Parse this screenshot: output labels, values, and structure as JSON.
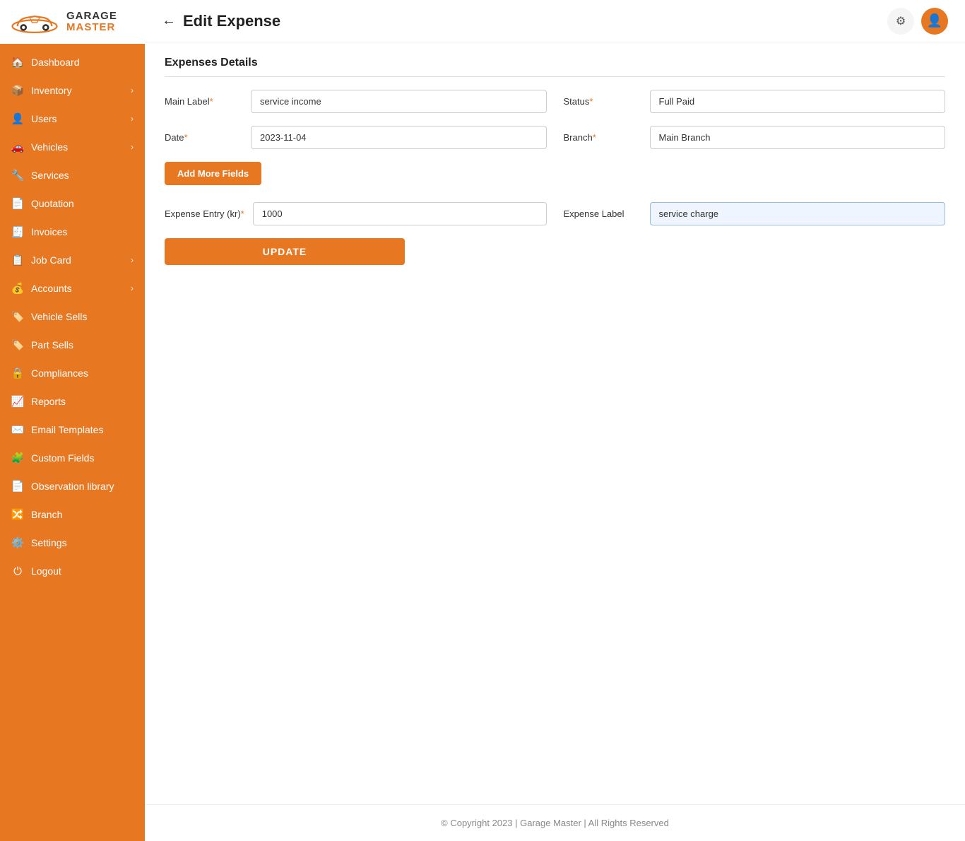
{
  "app": {
    "logo_garage": "GARAGE",
    "logo_master": "MASTER"
  },
  "sidebar": {
    "items": [
      {
        "id": "dashboard",
        "label": "Dashboard",
        "icon": "🏠",
        "hasArrow": false
      },
      {
        "id": "inventory",
        "label": "Inventory",
        "icon": "📦",
        "hasArrow": true
      },
      {
        "id": "users",
        "label": "Users",
        "icon": "👤",
        "hasArrow": true
      },
      {
        "id": "vehicles",
        "label": "Vehicles",
        "icon": "🚗",
        "hasArrow": true
      },
      {
        "id": "services",
        "label": "Services",
        "icon": "🔧",
        "hasArrow": false
      },
      {
        "id": "quotation",
        "label": "Quotation",
        "icon": "📄",
        "hasArrow": false
      },
      {
        "id": "invoices",
        "label": "Invoices",
        "icon": "🧾",
        "hasArrow": false
      },
      {
        "id": "job-card",
        "label": "Job Card",
        "icon": "📋",
        "hasArrow": true
      },
      {
        "id": "accounts",
        "label": "Accounts",
        "icon": "💰",
        "hasArrow": true
      },
      {
        "id": "vehicle-sells",
        "label": "Vehicle Sells",
        "icon": "🏷️",
        "hasArrow": false
      },
      {
        "id": "part-sells",
        "label": "Part Sells",
        "icon": "🏷️",
        "hasArrow": false
      },
      {
        "id": "compliances",
        "label": "Compliances",
        "icon": "🔒",
        "hasArrow": false
      },
      {
        "id": "reports",
        "label": "Reports",
        "icon": "📈",
        "hasArrow": false
      },
      {
        "id": "email-templates",
        "label": "Email Templates",
        "icon": "✉️",
        "hasArrow": false
      },
      {
        "id": "custom-fields",
        "label": "Custom Fields",
        "icon": "🧩",
        "hasArrow": false
      },
      {
        "id": "observation-library",
        "label": "Observation library",
        "icon": "📄",
        "hasArrow": false
      },
      {
        "id": "branch",
        "label": "Branch",
        "icon": "🔀",
        "hasArrow": false
      },
      {
        "id": "settings",
        "label": "Settings",
        "icon": "⚙️",
        "hasArrow": false
      },
      {
        "id": "logout",
        "label": "Logout",
        "icon": "⏻",
        "hasArrow": false
      }
    ]
  },
  "topbar": {
    "page_title": "Edit Expense",
    "back_label": "←"
  },
  "form": {
    "section_title": "Expenses Details",
    "main_label": {
      "label": "Main Label",
      "required": true,
      "value": "service income"
    },
    "status": {
      "label": "Status",
      "required": true,
      "value": "Full Paid"
    },
    "date": {
      "label": "Date",
      "required": true,
      "value": "2023-11-04"
    },
    "branch": {
      "label": "Branch",
      "required": true,
      "value": "Main Branch"
    },
    "add_more_btn": "Add More Fields",
    "expense_entry": {
      "label": "Expense Entry (kr)",
      "required": true,
      "value": "1000"
    },
    "expense_label": {
      "label": "Expense Label",
      "required": false,
      "value": "service charge"
    },
    "update_btn": "UPDATE"
  },
  "footer": {
    "text": "© Copyright 2023 | Garage Master | All Rights Reserved"
  }
}
